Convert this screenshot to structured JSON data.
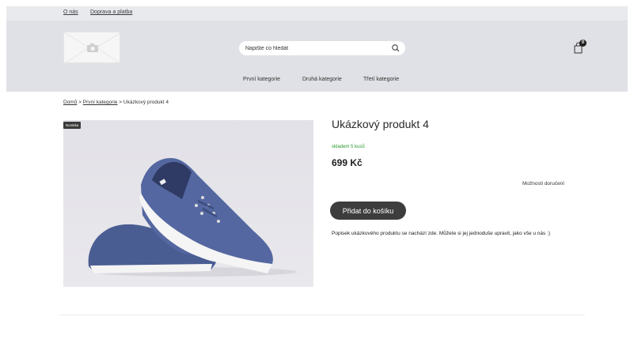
{
  "topbar": {
    "links": [
      "O nás",
      "Doprava a platba"
    ]
  },
  "search": {
    "placeholder": "Napište co hledát"
  },
  "cart": {
    "count": "0"
  },
  "nav": {
    "items": [
      "První kategorie",
      "Druhá kategorie",
      "Třetí kategorie"
    ]
  },
  "breadcrumb": {
    "home": "Domů",
    "separator": ">",
    "category": "První kategorie",
    "current": "Ukázkový produkt 4"
  },
  "product": {
    "badge": "Novinka",
    "title": "Ukázkový produkt 4",
    "stock": "skladem 5 kusů",
    "price": "699 Kč",
    "delivery_link": "Možnosti doručení",
    "add_to_cart": "Přidat do košíku",
    "description": "Popisek ukázkového produktu se nachází zde. Můžete si jej jednoduše upravit, jako vše u nás :)"
  },
  "colors": {
    "topbar_bg": "#e9eaee",
    "header_bg": "#e0e1e6",
    "button_bg": "#3d3d3d",
    "stock_green": "#2a9a2a",
    "shoe_blue": "#4a5d93"
  },
  "icons": {
    "search": "search-icon",
    "cart": "shopping-bag-icon",
    "logo": "camera-icon"
  }
}
